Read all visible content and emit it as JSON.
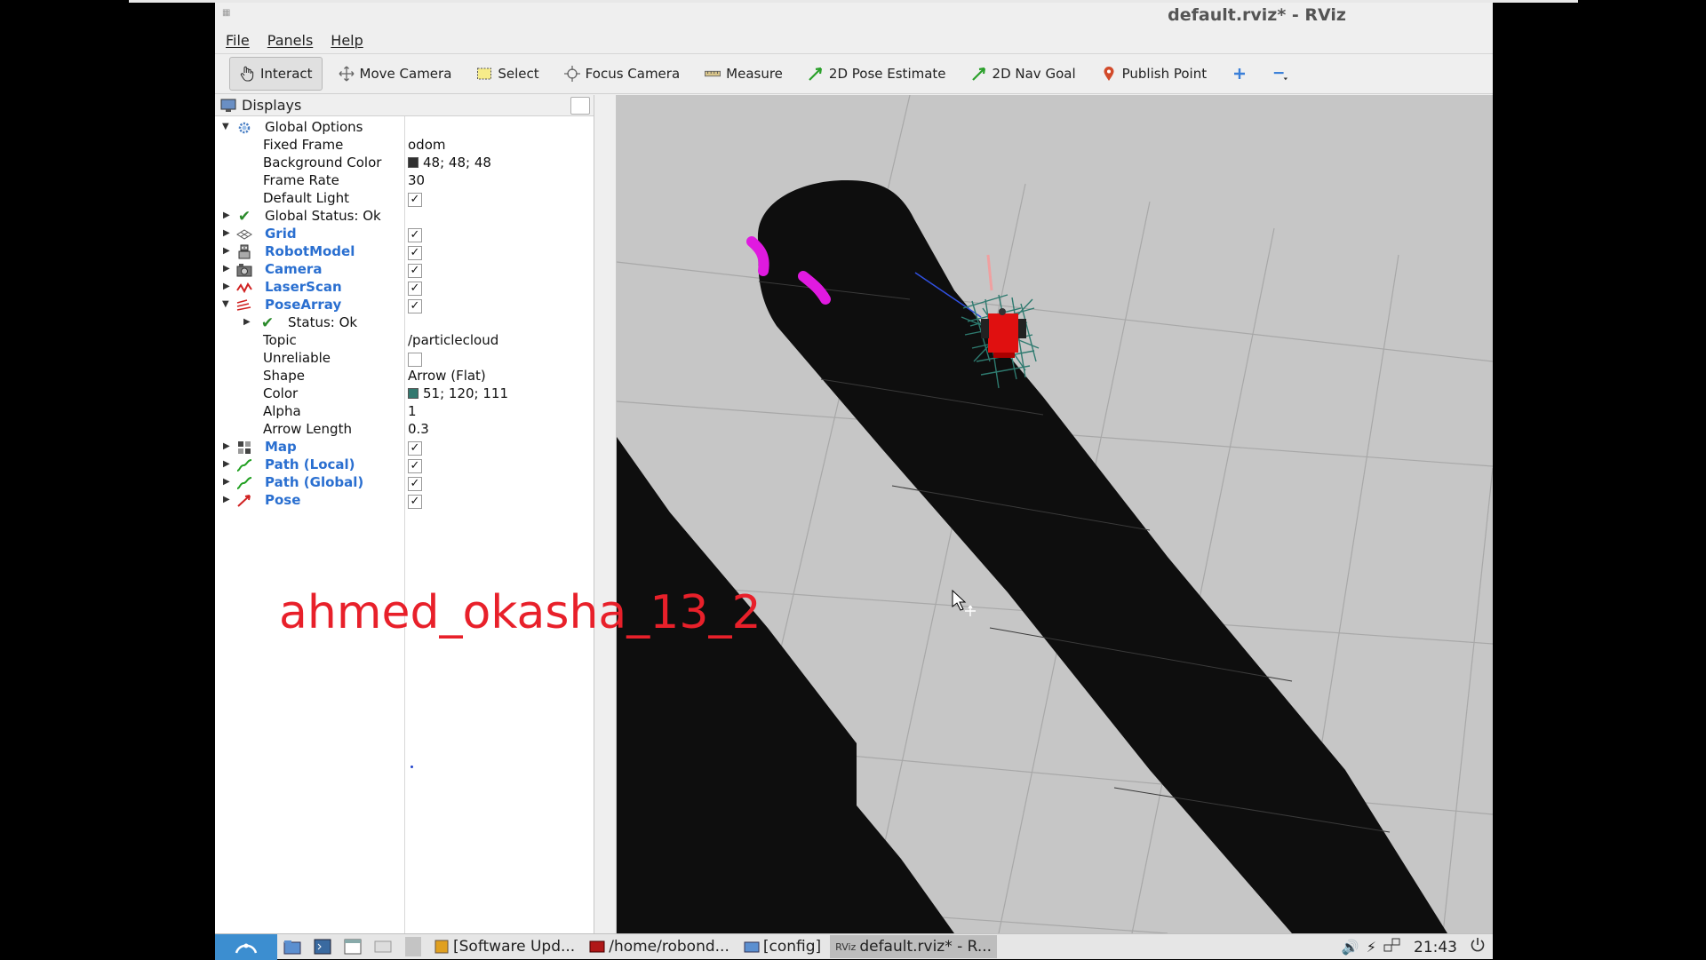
{
  "window": {
    "title": "default.rviz* - RViz"
  },
  "menu": [
    "File",
    "Panels",
    "Help"
  ],
  "toolbar": [
    {
      "label": "Interact",
      "icon": "hand-icon",
      "active": true
    },
    {
      "label": "Move Camera",
      "icon": "move-camera-icon"
    },
    {
      "label": "Select",
      "icon": "select-icon"
    },
    {
      "label": "Focus Camera",
      "icon": "focus-camera-icon"
    },
    {
      "label": "Measure",
      "icon": "ruler-icon"
    },
    {
      "label": "2D Pose Estimate",
      "icon": "green-arrow-icon"
    },
    {
      "label": "2D Nav Goal",
      "icon": "green-arrow-icon"
    },
    {
      "label": "Publish Point",
      "icon": "map-pin-icon"
    }
  ],
  "displays": {
    "title": "Displays",
    "global_options": "Global Options",
    "fixed_frame_label": "Fixed Frame",
    "fixed_frame": "odom",
    "bg_color_label": "Background Color",
    "bg_color": "48; 48; 48",
    "frame_rate_label": "Frame Rate",
    "frame_rate": "30",
    "default_light_label": "Default Light",
    "global_status": "Global Status: Ok",
    "grid": "Grid",
    "robot_model": "RobotModel",
    "camera": "Camera",
    "laser_scan": "LaserScan",
    "pose_array": "PoseArray",
    "status_ok": "Status: Ok",
    "topic_label": "Topic",
    "topic": "/particlecloud",
    "unreliable_label": "Unreliable",
    "shape_label": "Shape",
    "shape": "Arrow (Flat)",
    "color_label": "Color",
    "color": "51; 120; 111",
    "alpha_label": "Alpha",
    "alpha": "1",
    "arrow_length_label": "Arrow Length",
    "arrow_length": "0.3",
    "map": "Map",
    "path_local": "Path (Local)",
    "path_global": "Path (Global)",
    "pose": "Pose"
  },
  "colors": {
    "background_swatch": "#303030",
    "pose_color_swatch": "#33786f",
    "accent_blue": "#2a6fd0",
    "watermark_red": "#e8202a"
  },
  "watermark": "ahmed_okasha_13_2",
  "taskbar": {
    "tasks": [
      "[Software Upd...",
      "/home/robond...",
      "[config]",
      "default.rviz* - R..."
    ],
    "time": "21:43"
  }
}
